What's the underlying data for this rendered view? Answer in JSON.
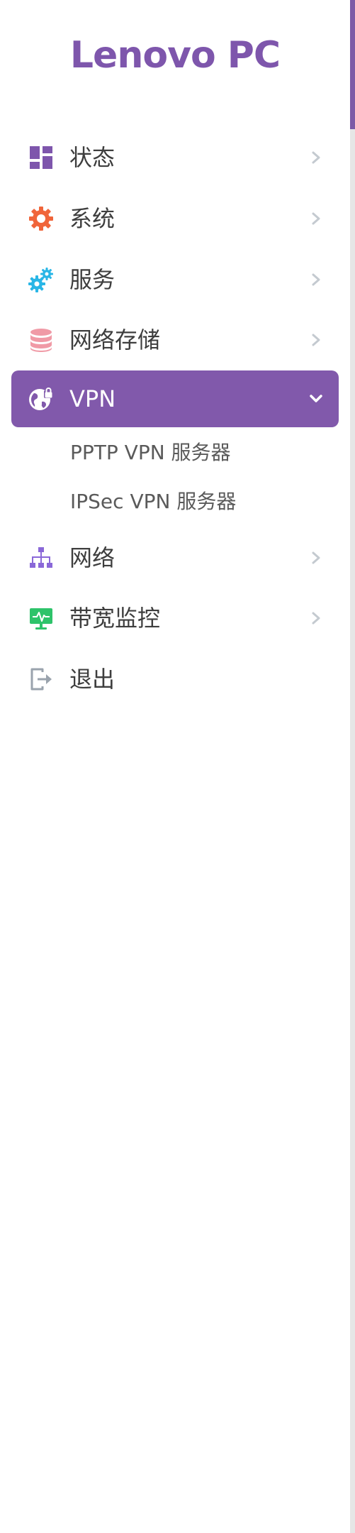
{
  "brand": "Lenovo PC",
  "menu": {
    "items": [
      {
        "label": "状态",
        "icon": "dashboard-icon",
        "color": "#7e56ac"
      },
      {
        "label": "系统",
        "icon": "gear-icon",
        "color": "#f0653a"
      },
      {
        "label": "服务",
        "icon": "gears-icon",
        "color": "#29b6e6"
      },
      {
        "label": "网络存储",
        "icon": "database-icon",
        "color": "#f09aa6"
      },
      {
        "label": "VPN",
        "icon": "globe-lock-icon",
        "color": "#ffffff",
        "active": true
      },
      {
        "label": "网络",
        "icon": "sitemap-icon",
        "color": "#8a68d8"
      },
      {
        "label": "带宽监控",
        "icon": "monitor-pulse-icon",
        "color": "#2ec36a"
      },
      {
        "label": "退出",
        "icon": "sign-out-icon",
        "color": "#9aa3ad"
      }
    ],
    "vpn_submenu": [
      {
        "label": "PPTP VPN 服务器"
      },
      {
        "label": "IPSec VPN 服务器"
      }
    ]
  },
  "colors": {
    "accent": "#8159ab",
    "chevron": "#c4cad0"
  }
}
